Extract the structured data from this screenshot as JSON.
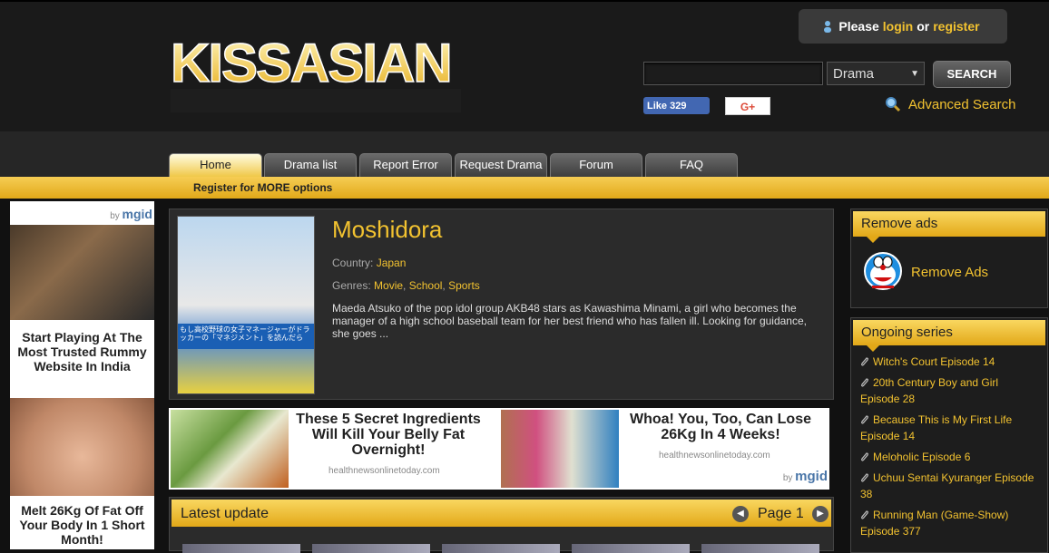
{
  "header": {
    "login": {
      "prefix": "Please",
      "login_link": "login",
      "or": "or",
      "register_link": "register"
    },
    "search": {
      "input_value": "",
      "select_value": "Drama",
      "button": "SEARCH"
    },
    "facebook": {
      "label": "Like",
      "count": "329"
    },
    "gplus": {
      "label": "G+"
    },
    "advanced_search": "Advanced Search"
  },
  "nav": {
    "tabs": [
      {
        "label": "Home"
      },
      {
        "label": "Drama list"
      },
      {
        "label": "Report Error"
      },
      {
        "label": "Request Drama"
      },
      {
        "label": "Forum"
      },
      {
        "label": "FAQ"
      }
    ],
    "subbar_text": "Register for MORE options"
  },
  "left_ad": {
    "by": "by",
    "brand": "mgid",
    "items": [
      {
        "title": "Start Playing At The Most Trusted Rummy Website In India"
      },
      {
        "title": "Melt 26Kg Of Fat Off Your Body In 1 Short Month!"
      }
    ]
  },
  "drama": {
    "title": "Moshidora",
    "country_label": "Country:",
    "country": "Japan",
    "genres_label": "Genres:",
    "genres": [
      "Movie",
      "School",
      "Sports"
    ],
    "description": "Maeda Atsuko of the pop idol group AKB48 stars as Kawashima Minami, a girl who becomes the manager of a high school baseball team for her best friend who has fallen ill. Looking for guidance, she goes ...",
    "poster_text": "もし高校野球の女子マネージャーがドラッカーの「マネジメント」を読んだら"
  },
  "mid_ad": {
    "items": [
      {
        "title": "These 5 Secret Ingredients Will Kill Your Belly Fat Overnight!",
        "source": "healthnewsonlinetoday.com"
      },
      {
        "title": "Whoa! You, Too, Can Lose 26Kg In 4 Weeks!",
        "source": "healthnewsonlinetoday.com"
      }
    ],
    "by": "by",
    "brand": "mgid"
  },
  "latest": {
    "label": "Latest update",
    "page": "Page 1"
  },
  "sidebar": {
    "remove_ads": {
      "heading": "Remove ads",
      "link": "Remove Ads"
    },
    "ongoing": {
      "heading": "Ongoing series",
      "items": [
        "Witch's Court Episode 14",
        "20th Century Boy and Girl Episode 28",
        "Because This is My First Life Episode 14",
        "Meloholic Episode 6",
        "Uchuu Sentai Kyuranger Episode 38",
        "Running Man (Game-Show) Episode 377"
      ]
    }
  },
  "colors": {
    "accent": "#f2c230",
    "background": "#111111"
  }
}
